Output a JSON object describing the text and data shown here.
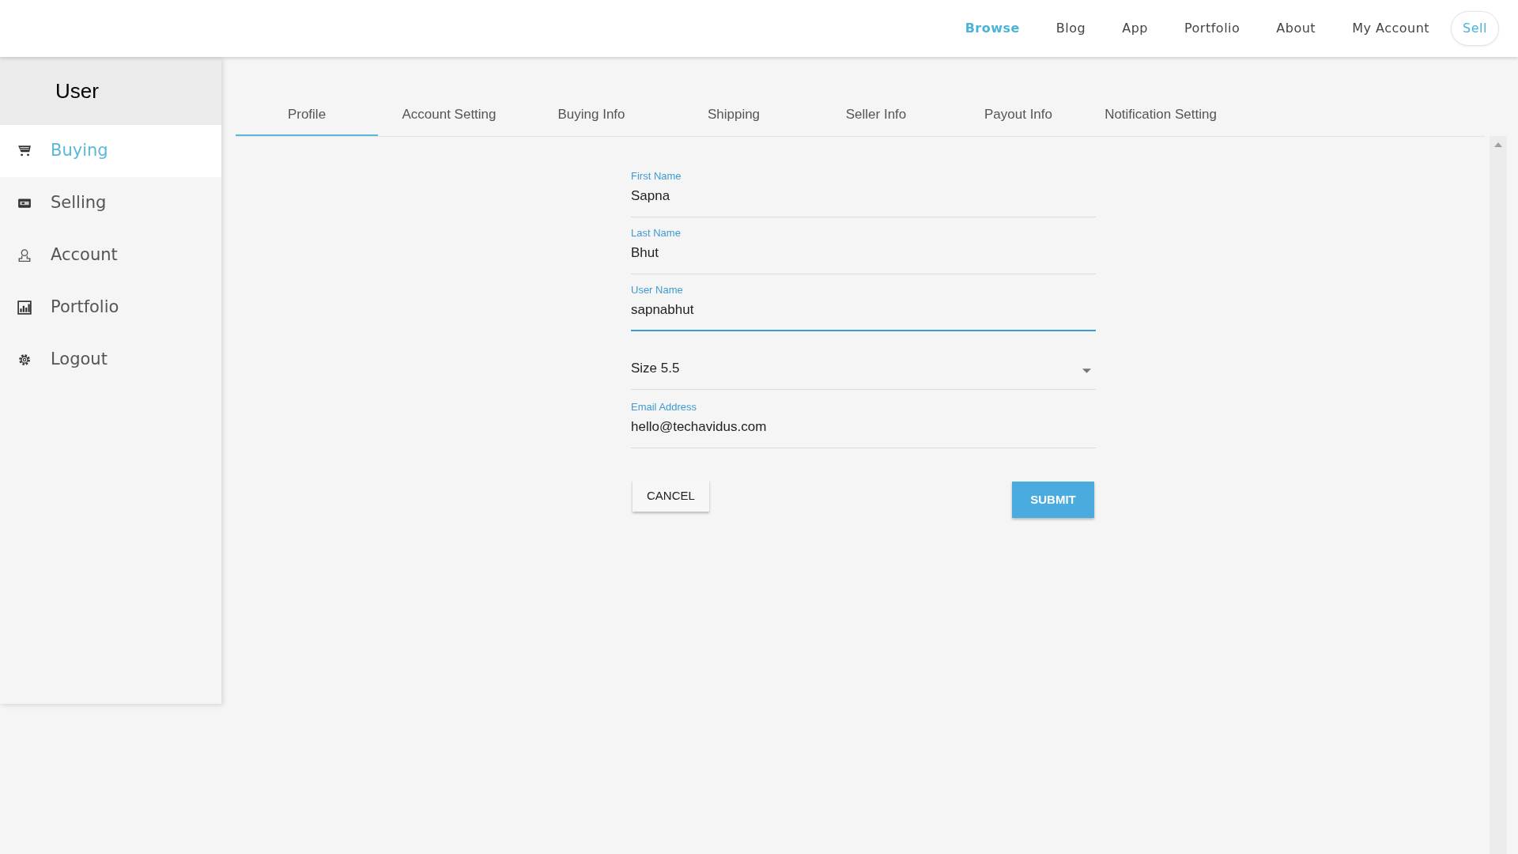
{
  "nav": [
    {
      "label": "Browse",
      "selected": true
    },
    {
      "label": "Blog",
      "selected": false
    },
    {
      "label": "App",
      "selected": false
    },
    {
      "label": "Portfolio",
      "selected": false
    },
    {
      "label": "About",
      "selected": false
    },
    {
      "label": "My Account",
      "selected": false
    }
  ],
  "sell_button": "Sell",
  "sidebar": {
    "title": "User",
    "items": [
      {
        "label": "Buying",
        "selected": true
      },
      {
        "label": "Selling",
        "selected": false
      },
      {
        "label": "Account",
        "selected": false
      },
      {
        "label": "Portfolio",
        "selected": false
      },
      {
        "label": "Logout",
        "selected": false
      }
    ]
  },
  "tabs": [
    {
      "label": "Profile",
      "selected": true
    },
    {
      "label": "Account Setting",
      "selected": false
    },
    {
      "label": "Buying Info",
      "selected": false
    },
    {
      "label": "Shipping",
      "selected": false
    },
    {
      "label": "Seller Info",
      "selected": false
    },
    {
      "label": "Payout Info",
      "selected": false
    },
    {
      "label": "Notification Setting",
      "selected": false
    }
  ],
  "form": {
    "fields": [
      {
        "kind": "text",
        "label": "First Name",
        "value": "Sapna",
        "focused": false
      },
      {
        "kind": "text",
        "label": "Last Name",
        "value": "Bhut",
        "focused": false
      },
      {
        "kind": "text",
        "label": "User Name",
        "value": "sapnabhut",
        "focused": true
      },
      {
        "kind": "select",
        "value": "Size 5.5"
      },
      {
        "kind": "text",
        "label": "Email Address",
        "value": "hello@techavidus.com",
        "focused": false
      }
    ],
    "cancel_button": "CANCEL",
    "submit_button": "SUBMIT"
  }
}
